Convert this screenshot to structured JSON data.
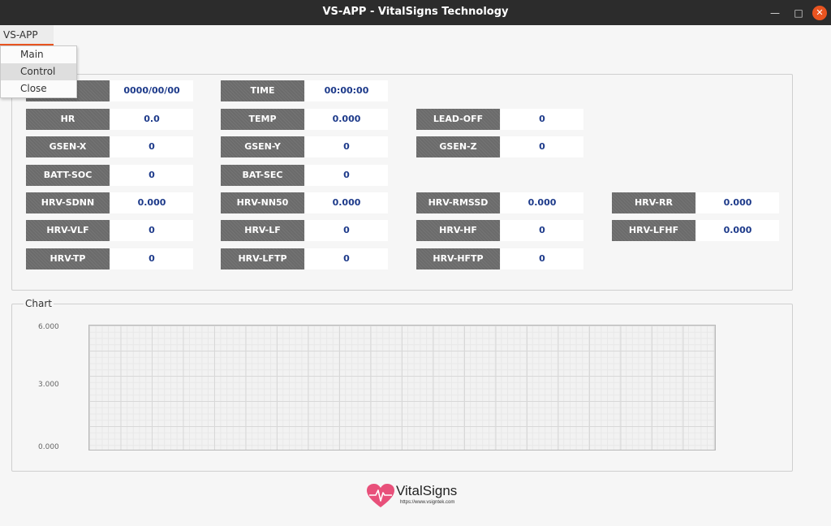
{
  "window": {
    "title": "VS-APP - VitalSigns Technology"
  },
  "menubar": {
    "menu_title": "VS-APP",
    "items": [
      {
        "label": "Main"
      },
      {
        "label": "Control"
      },
      {
        "label": "Close"
      }
    ]
  },
  "info_panel": {
    "date_value": "0000/00/00",
    "time_label": "TIME",
    "time_value": "00:00:00",
    "hr_label": "HR",
    "hr_value": "0.0",
    "temp_label": "TEMP",
    "temp_value": "0.000",
    "leadoff_label": "LEAD-OFF",
    "leadoff_value": "0",
    "gsenx_label": "GSEN-X",
    "gsenx_value": "0",
    "gseny_label": "GSEN-Y",
    "gseny_value": "0",
    "gsenz_label": "GSEN-Z",
    "gsenz_value": "0",
    "battsoc_label": "BATT-SOC",
    "battsoc_value": "0",
    "batsec_label": "BAT-SEC",
    "batsec_value": "0",
    "sdnn_label": "HRV-SDNN",
    "sdnn_value": "0.000",
    "nn50_label": "HRV-NN50",
    "nn50_value": "0.000",
    "rmssd_label": "HRV-RMSSD",
    "rmssd_value": "0.000",
    "rr_label": "HRV-RR",
    "rr_value": "0.000",
    "vlf_label": "HRV-VLF",
    "vlf_value": "0",
    "lf_label": "HRV-LF",
    "lf_value": "0",
    "hf_label": "HRV-HF",
    "hf_value": "0",
    "lfhf_label": "HRV-LFHF",
    "lfhf_value": "0.000",
    "tp_label": "HRV-TP",
    "tp_value": "0",
    "lftp_label": "HRV-LFTP",
    "lftp_value": "0",
    "hftp_label": "HRV-HFTP",
    "hftp_value": "0"
  },
  "chart_panel": {
    "legend": "Chart",
    "y_ticks": [
      "6.000",
      "3.000",
      "0.000"
    ]
  },
  "chart_data": {
    "type": "line",
    "ylim": [
      0,
      6
    ],
    "yticks": [
      6,
      3,
      0
    ],
    "series": [],
    "grid": true
  },
  "footer": {
    "brand": "VitalSigns",
    "url": "https://www.vsigntek.com"
  },
  "colors": {
    "accent": "#e95420",
    "label_bg": "#6b6b6b",
    "value_text": "#1d3a8a",
    "logo_pink": "#e8507a"
  }
}
